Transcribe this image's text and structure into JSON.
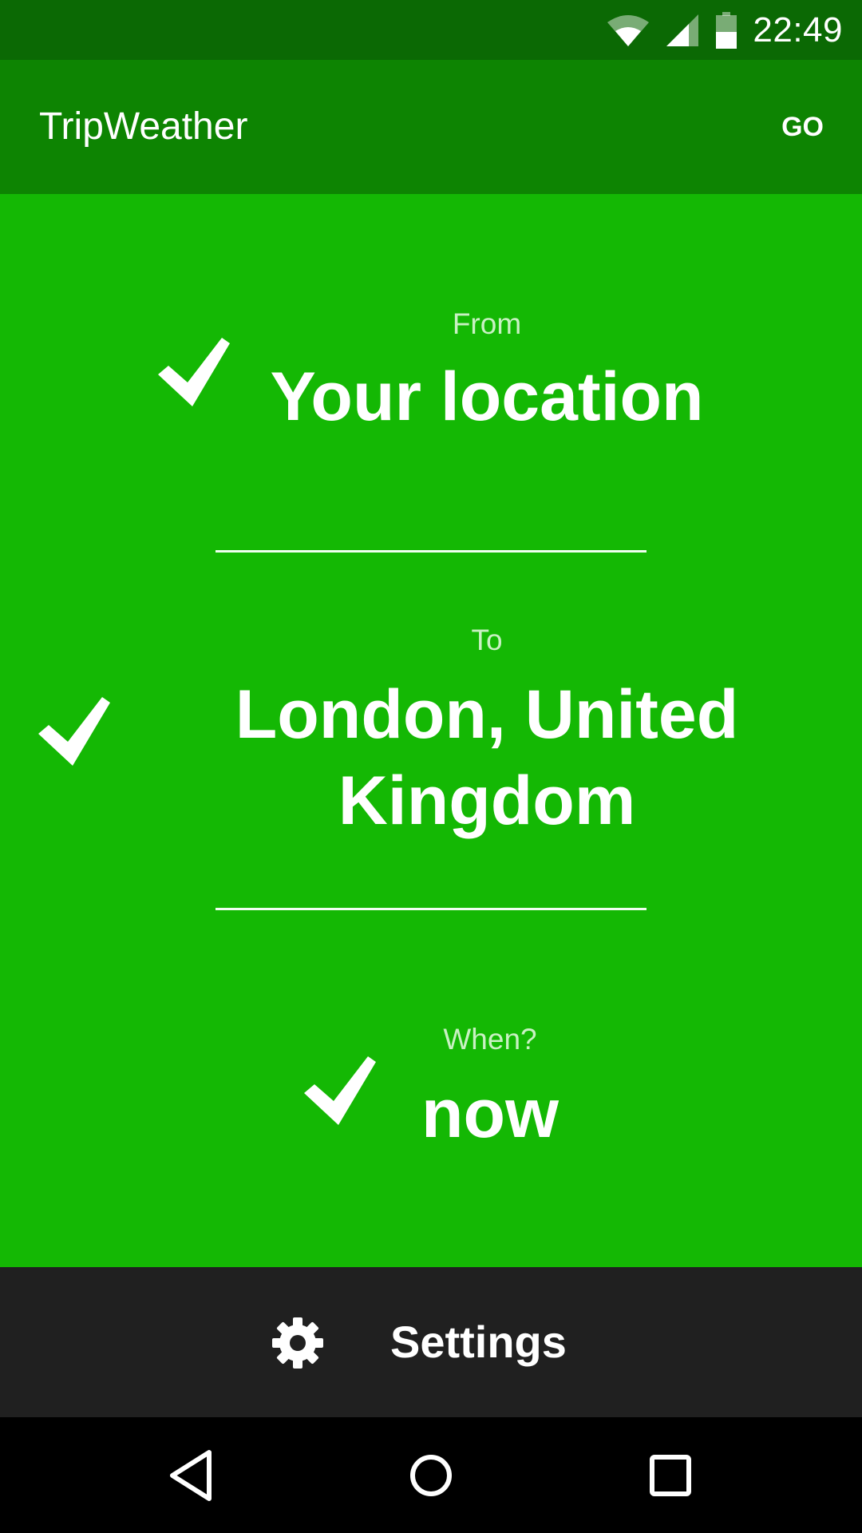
{
  "status_bar": {
    "time": "22:49",
    "icons": [
      "wifi-icon",
      "signal-icon",
      "battery-icon"
    ]
  },
  "app_bar": {
    "title": "TripWeather",
    "go_label": "GO"
  },
  "trip": {
    "from_label": "From",
    "from_value": "Your location",
    "to_label": "To",
    "to_value_line1": "London, United",
    "to_value_line2": "Kingdom",
    "when_label": "When?",
    "when_value": "now"
  },
  "settings": {
    "label": "Settings",
    "icon": "gear-icon"
  },
  "nav": {
    "icons": [
      "back-icon",
      "home-icon",
      "recents-icon"
    ]
  },
  "colors": {
    "status_bar": "#0b6904",
    "app_bar": "#0d8402",
    "main_bg": "#14b804",
    "settings_bg": "#202020",
    "nav_bg": "#000000",
    "label_tint": "#c9f1c3"
  }
}
